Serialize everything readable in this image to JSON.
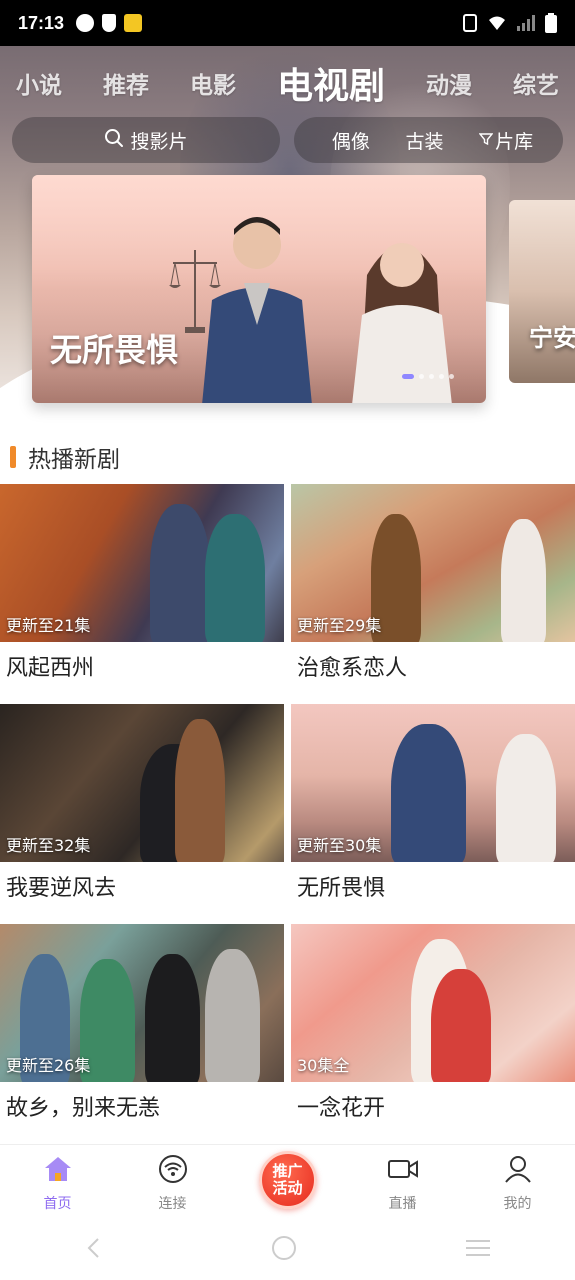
{
  "status_bar": {
    "time": "17:13"
  },
  "categories": [
    {
      "label": "小说",
      "active": false
    },
    {
      "label": "推荐",
      "active": false
    },
    {
      "label": "电影",
      "active": false
    },
    {
      "label": "电视剧",
      "active": true
    },
    {
      "label": "动漫",
      "active": false
    },
    {
      "label": "综艺",
      "active": false
    }
  ],
  "search": {
    "label": "搜影片"
  },
  "filters": {
    "idol": "偶像",
    "costume": "古装",
    "library": "片库"
  },
  "banner": {
    "title": "无所畏惧",
    "next_title": "宁安"
  },
  "section": {
    "title": "热播新剧"
  },
  "dramas": [
    {
      "title": "风起西州",
      "badge": "更新至21集"
    },
    {
      "title": "治愈系恋人",
      "badge": "更新至29集"
    },
    {
      "title": "我要逆风去",
      "badge": "更新至32集"
    },
    {
      "title": "无所畏惧",
      "badge": "更新至30集"
    },
    {
      "title": "故乡，别来无恙",
      "badge": "更新至26集"
    },
    {
      "title": "一念花开",
      "badge": "30集全"
    }
  ],
  "bottom_nav": {
    "home": "首页",
    "connect": "连接",
    "promo_line1": "推广",
    "promo_line2": "活动",
    "live": "直播",
    "mine": "我的"
  },
  "colors": {
    "accent": "#8f6cf0",
    "section_bar": "#f08a2a",
    "promo": "#e62a1e"
  }
}
